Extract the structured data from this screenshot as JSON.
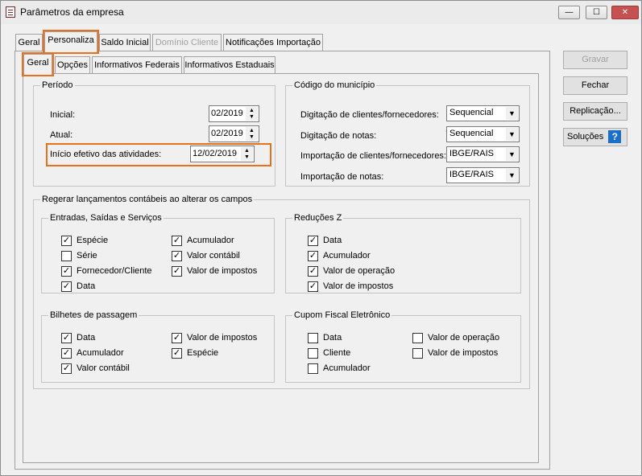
{
  "window": {
    "title": "Parâmetros da empresa",
    "minimize_glyph": "—",
    "maximize_glyph": "☐",
    "close_glyph": "✕"
  },
  "outer_tabs": [
    {
      "label": "Geral",
      "state": "normal"
    },
    {
      "label": "Personaliza",
      "state": "active"
    },
    {
      "label": "Saldo Inicial",
      "state": "normal"
    },
    {
      "label": "Domínio Cliente",
      "state": "disabled"
    },
    {
      "label": "Notificações Importação",
      "state": "normal"
    }
  ],
  "inner_tabs": [
    {
      "label": "Geral",
      "state": "active"
    },
    {
      "label": "Opções",
      "state": "normal"
    },
    {
      "label": "Informativos Federais",
      "state": "normal"
    },
    {
      "label": "Informativos Estaduais",
      "state": "normal"
    }
  ],
  "periodo": {
    "legend": "Período",
    "inicial_label": "Inicial:",
    "inicial_value": "02/2019",
    "atual_label": "Atual:",
    "atual_value": "02/2019",
    "inicio_label": "Início efetivo das atividades:",
    "inicio_value": "12/02/2019"
  },
  "municipio": {
    "legend": "Código do município",
    "rows": [
      {
        "label": "Digitação de clientes/fornecedores:",
        "value": "Sequencial"
      },
      {
        "label": "Digitação de notas:",
        "value": "Sequencial"
      },
      {
        "label": "Importação de clientes/fornecedores:",
        "value": "IBGE/RAIS"
      },
      {
        "label": "Importação de notas:",
        "value": "IBGE/RAIS"
      }
    ]
  },
  "regerar": {
    "legend": "Regerar lançamentos contábeis ao alterar os campos",
    "entradas": {
      "legend": "Entradas, Saídas e Serviços",
      "items": [
        {
          "label": "Espécie",
          "checked": true
        },
        {
          "label": "Série",
          "checked": false
        },
        {
          "label": "Fornecedor/Cliente",
          "checked": true
        },
        {
          "label": "Data",
          "checked": true
        },
        {
          "label": "Acumulador",
          "checked": true
        },
        {
          "label": "Valor contábil",
          "checked": true
        },
        {
          "label": "Valor de impostos",
          "checked": true
        }
      ]
    },
    "reducoes": {
      "legend": "Reduções Z",
      "items": [
        {
          "label": "Data",
          "checked": true
        },
        {
          "label": "Acumulador",
          "checked": true
        },
        {
          "label": "Valor de operação",
          "checked": true
        },
        {
          "label": "Valor de impostos",
          "checked": true
        }
      ]
    },
    "bilhetes": {
      "legend": "Bilhetes de passagem",
      "items": [
        {
          "label": "Data",
          "checked": true
        },
        {
          "label": "Acumulador",
          "checked": true
        },
        {
          "label": "Valor contábil",
          "checked": true
        },
        {
          "label": "Valor de impostos",
          "checked": true
        },
        {
          "label": "Espécie",
          "checked": true
        }
      ]
    },
    "cupom": {
      "legend": "Cupom Fiscal Eletrônico",
      "items": [
        {
          "label": "Data",
          "checked": false
        },
        {
          "label": "Cliente",
          "checked": false
        },
        {
          "label": "Acumulador",
          "checked": false
        },
        {
          "label": "Valor de operação",
          "checked": false
        },
        {
          "label": "Valor de impostos",
          "checked": false
        }
      ]
    }
  },
  "buttons": {
    "gravar": "Gravar",
    "fechar": "Fechar",
    "replicacao": "Replicação...",
    "solucoes": "Soluções",
    "help_glyph": "?"
  },
  "glyphs": {
    "check": "✓",
    "up": "▲",
    "down": "▼",
    "drop": "▼"
  },
  "colors": {
    "highlight": "#e8711a",
    "help_blue": "#1c6fc8",
    "close_red": "#c75050"
  }
}
